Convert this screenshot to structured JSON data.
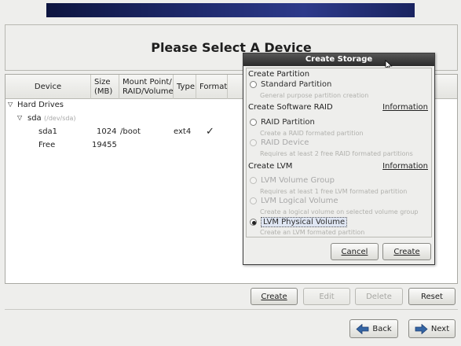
{
  "page": {
    "title": "Please Select A Device"
  },
  "tree": {
    "columns": {
      "device": "Device",
      "size_1": "Size",
      "size_2": "(MB)",
      "mount_1": "Mount Point/",
      "mount_2": "RAID/Volume",
      "type": "Type",
      "format": "Format"
    },
    "group": "Hard Drives",
    "disk": {
      "name": "sda",
      "path": "(/dev/sda)"
    },
    "rows": [
      {
        "device": "sda1",
        "size": "1024",
        "mount": "/boot",
        "type": "ext4",
        "format": "✓"
      },
      {
        "device": "Free",
        "size": "19455",
        "mount": "",
        "type": "",
        "format": ""
      }
    ]
  },
  "toolbar": {
    "create": "Create",
    "edit": "Edit",
    "delete": "Delete",
    "reset": "Reset"
  },
  "nav": {
    "back": "Back",
    "next": "Next"
  },
  "dialog": {
    "title": "Create Storage",
    "create_partition": "Create Partition",
    "standard_partition": "Standard Partition",
    "standard_partition_hint": "General purpose partition creation",
    "create_raid": "Create Software RAID",
    "information": "Information",
    "raid_partition": "RAID Partition",
    "raid_partition_hint": "Create a RAID formated partition",
    "raid_device": "RAID Device",
    "raid_device_hint": "Requires at least 2 free RAID formated partitions",
    "create_lvm": "Create LVM",
    "lvm_volume_group": "LVM Volume Group",
    "lvm_volume_group_hint": "Requires at least 1 free LVM formated partition",
    "lvm_logical_volume": "LVM Logical Volume",
    "lvm_logical_volume_hint": "Create a logical volume on selected volume group",
    "lvm_physical_volume": "LVM Physical Volume",
    "lvm_physical_volume_hint": "Create an LVM formated partition",
    "cancel": "Cancel",
    "create": "Create"
  }
}
